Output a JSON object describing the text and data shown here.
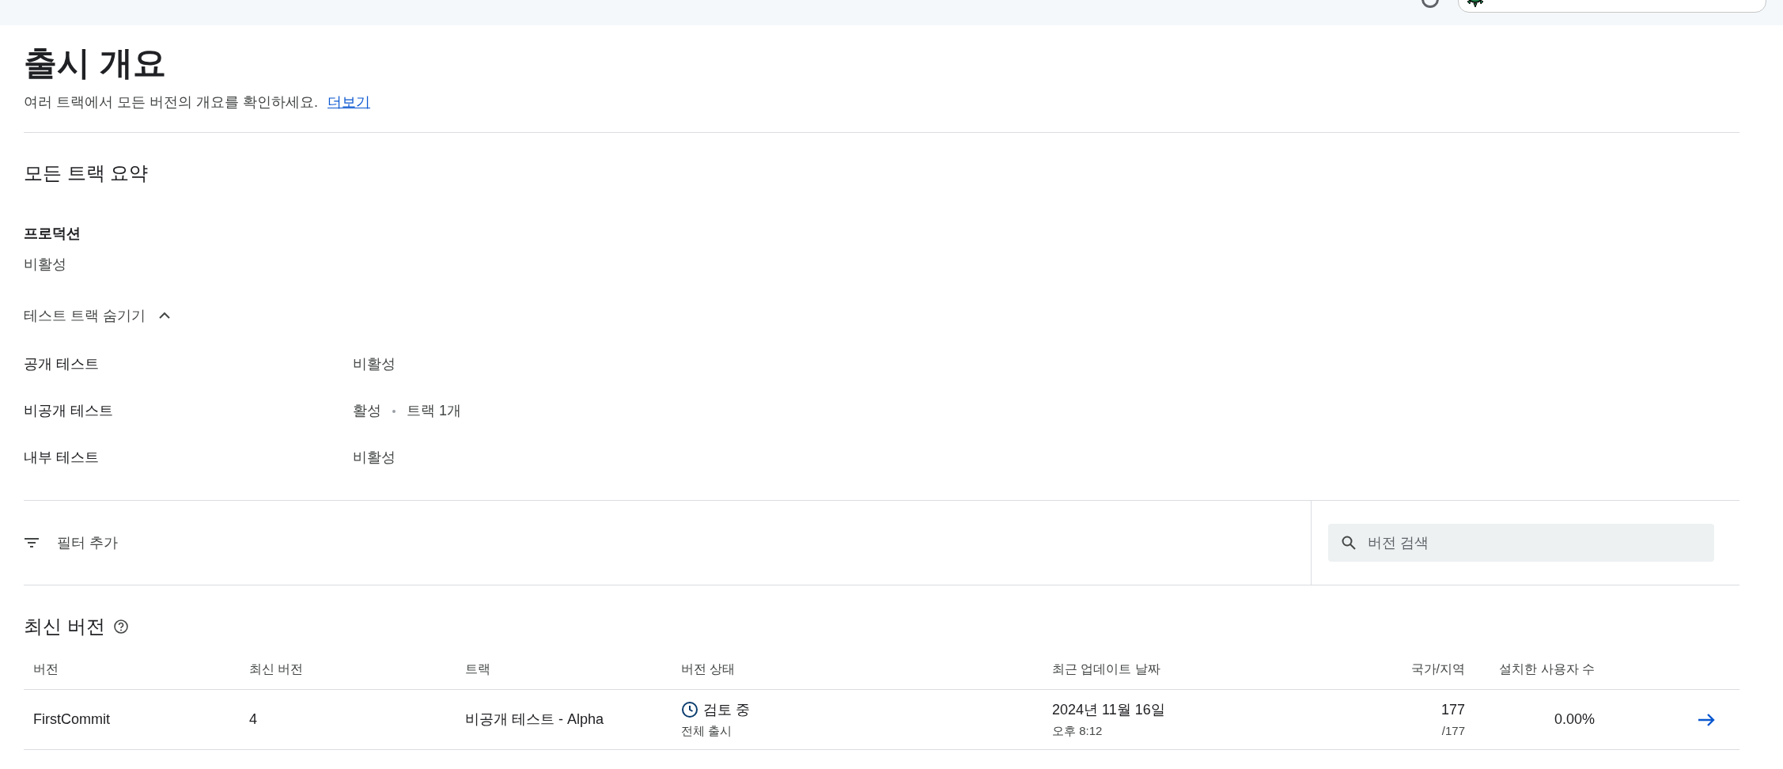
{
  "page": {
    "title": "출시 개요",
    "description": "여러 트랙에서 모든 버전의 개요를 확인하세요.",
    "more_link": "더보기"
  },
  "summary": {
    "heading": "모든 트랙 요약",
    "production": {
      "label": "프로덕션",
      "status": "비활성"
    },
    "toggle": {
      "label": "테스트 트랙 숨기기",
      "expanded": true
    },
    "tracks": [
      {
        "name": "공개 테스트",
        "status": "비활성"
      },
      {
        "name": "비공개 테스트",
        "status": "활성",
        "detail": "트랙 1개"
      },
      {
        "name": "내부 테스트",
        "status": "비활성"
      }
    ]
  },
  "filter": {
    "label": "필터 추가"
  },
  "search": {
    "placeholder": "버전 검색"
  },
  "latest": {
    "heading": "최신 버전",
    "columns": [
      "버전",
      "최신 버전",
      "트랙",
      "버전 상태",
      "최근 업데이트 날짜",
      "국가/지역",
      "설치한 사용자 수"
    ],
    "rows": [
      {
        "version": "FirstCommit",
        "latest": "4",
        "track": "비공개 테스트 - Alpha",
        "status": "검토 중",
        "rollout": "전체 출시",
        "date": "2024년 11월 16일",
        "time": "오후 8:12",
        "countries": "177",
        "countries_total": "/177",
        "installs": "0.00%"
      }
    ]
  }
}
